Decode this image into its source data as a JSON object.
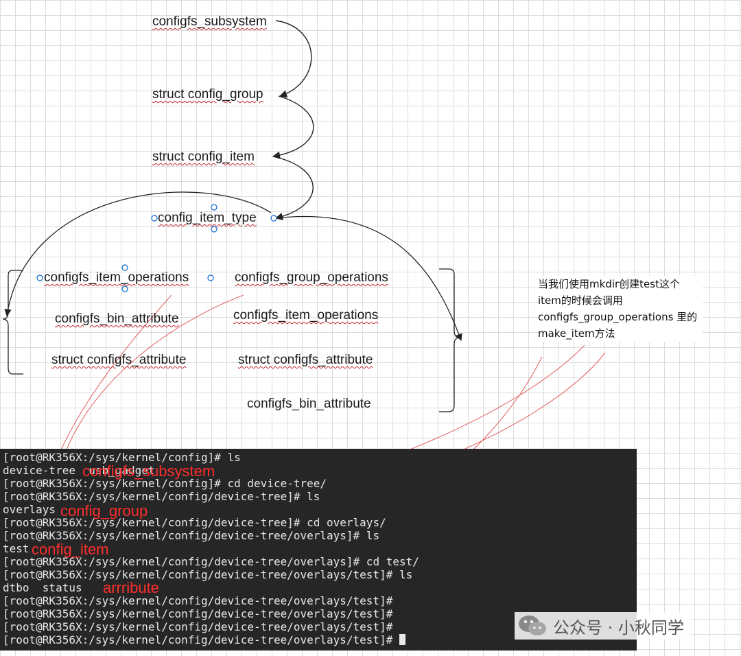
{
  "diagram": {
    "nodes": {
      "configfs_subsystem": "configfs_subsystem",
      "config_group": "struct config_group",
      "config_item": "struct config_item",
      "config_item_type": "config_item_type"
    },
    "left_group": [
      "configfs_item_operations",
      "configfs_bin_attribute",
      "struct configfs_attribute"
    ],
    "right_group": [
      "configfs_group_operations",
      "configfs_item_operations",
      "struct configfs_attribute",
      "configfs_bin_attribute"
    ],
    "note": "当我们使用mkdir创建test这个item的时候会调用configfs_group_operations 里的make_item方法"
  },
  "terminal": {
    "lines": [
      "[root@RK356X:/sys/kernel/config]# ls",
      "device-tree  usb_gadget",
      "[root@RK356X:/sys/kernel/config]# cd device-tree/",
      "[root@RK356X:/sys/kernel/config/device-tree]# ls",
      "overlays",
      "[root@RK356X:/sys/kernel/config/device-tree]# cd overlays/",
      "[root@RK356X:/sys/kernel/config/device-tree/overlays]# ls",
      "test",
      "[root@RK356X:/sys/kernel/config/device-tree/overlays]# cd test/",
      "[root@RK356X:/sys/kernel/config/device-tree/overlays/test]# ls",
      "dtbo  status",
      "[root@RK356X:/sys/kernel/config/device-tree/overlays/test]#",
      "[root@RK356X:/sys/kernel/config/device-tree/overlays/test]#",
      "[root@RK356X:/sys/kernel/config/device-tree/overlays/test]#",
      "[root@RK356X:/sys/kernel/config/device-tree/overlays/test]# "
    ],
    "annotations": {
      "subsystem": "configfs_subsystem",
      "group": "config_group",
      "item": "config_item",
      "attribute": "arrribute"
    }
  },
  "watermark": {
    "text": "公众号 · 小秋同学",
    "icon": "wechat-icon"
  },
  "colors": {
    "annotation_red": "#ff2d2d",
    "arrow": "#222222",
    "handle_blue": "#2b7bd6",
    "squiggle_red": "#c62828",
    "terminal_bg": "#262626"
  }
}
